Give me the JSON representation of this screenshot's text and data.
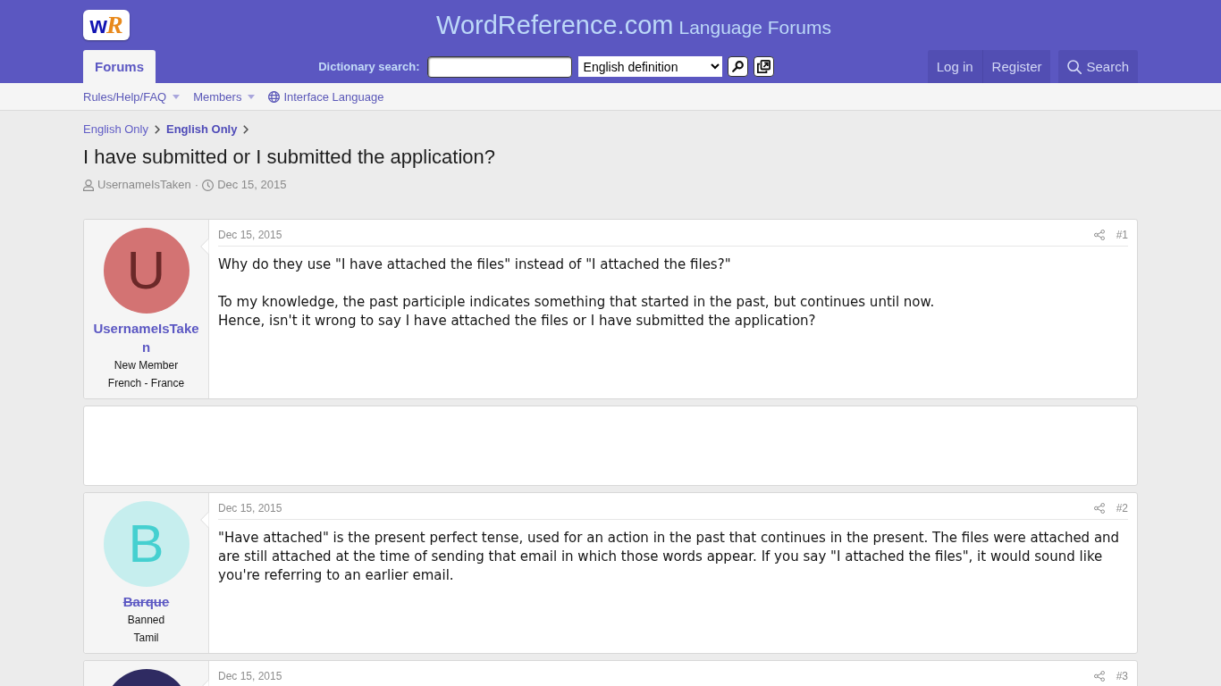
{
  "header": {
    "logo": [
      "w",
      "R"
    ],
    "site_name": "WordReference.com",
    "site_subtitle": "Language Forums"
  },
  "tabs": [
    {
      "label": "Forums",
      "selected": true
    }
  ],
  "dictionary_search": {
    "label": "Dictionary search:",
    "dictionary": "English definition"
  },
  "account": [
    {
      "label": "Log in"
    },
    {
      "label": "Register"
    }
  ],
  "search_button": {
    "label": "Search"
  },
  "nav": [
    {
      "label": "Rules/Help/FAQ",
      "kind": "menu"
    },
    {
      "label": "Members",
      "kind": "menu"
    },
    {
      "label": "Interface Language",
      "kind": "language"
    }
  ],
  "breadcrumb": [
    {
      "label": "English Only",
      "current": false
    },
    {
      "label": "English Only",
      "current": true
    }
  ],
  "thread": {
    "title": "I have submitted or I submitted the application?",
    "author": "UsernameIsTaken",
    "separator": "·",
    "date": "Dec 15, 2015"
  },
  "posts": [
    {
      "kind": "message",
      "avatar": {
        "color": "#d37373",
        "letter": {
          "text": "U",
          "color": "#6b2828"
        }
      },
      "username": "UsernameIsTaken",
      "struck": false,
      "user_title": "New Member",
      "language": "French - France",
      "date": "Dec 15, 2015",
      "number": "#1",
      "body": [
        "Why do they use \"I have attached the files\" instead of \"I attached the files?\"",
        "To my knowledge, the past participle indicates something that started in the past, but continues until now.\nHence, isn't it wrong to say I have attached the files or I have submitted the application?"
      ]
    },
    {
      "kind": "blank"
    },
    {
      "kind": "message",
      "avatar": {
        "color": "#c6eeee",
        "letter": {
          "text": "B",
          "color": "#45d0d0"
        }
      },
      "username": "Barque",
      "struck": true,
      "user_title": "Banned",
      "language": "Tamil",
      "date": "Dec 15, 2015",
      "number": "#2",
      "body": [
        "\"Have attached\" is the present perfect tense, used for an action in the past that continues in the present. The files were attached and are still attached at the time of sending that email in which those words appear. If you say \"I attached the files\", it would sound like you're referring to an earlier email."
      ]
    },
    {
      "kind": "message",
      "avatar": {
        "color": "#2f2b62"
      },
      "date": "Dec 15, 2015",
      "number": "#3"
    }
  ]
}
